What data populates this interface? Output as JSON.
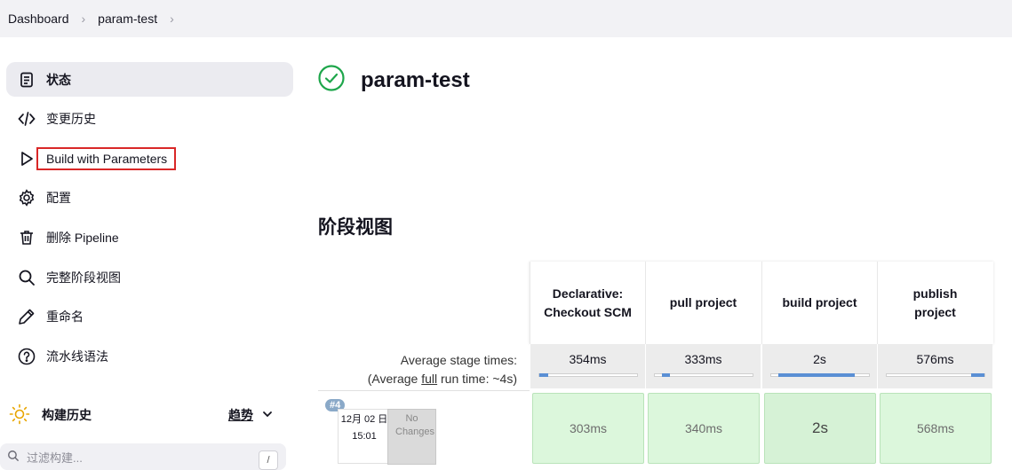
{
  "breadcrumb": {
    "items": [
      "Dashboard",
      "param-test"
    ]
  },
  "sidebar": {
    "items": [
      {
        "label": "状态",
        "icon": "document-icon",
        "active": true
      },
      {
        "label": "变更历史",
        "icon": "code-icon"
      },
      {
        "label": "Build with Parameters",
        "icon": "play-icon",
        "highlighted": true
      },
      {
        "label": "配置",
        "icon": "gear-icon"
      },
      {
        "label": "删除 Pipeline",
        "icon": "trash-icon"
      },
      {
        "label": "完整阶段视图",
        "icon": "search-icon"
      },
      {
        "label": "重命名",
        "icon": "pencil-icon"
      },
      {
        "label": "流水线语法",
        "icon": "help-icon"
      }
    ]
  },
  "build_history": {
    "title": "构建历史",
    "trend_label": "趋势",
    "filter_placeholder": "过滤构建...",
    "filter_shortcut": "/"
  },
  "main": {
    "title": "param-test",
    "status_color": "#1ea64b",
    "stage_view_title": "阶段视图",
    "avg_label_line1": "Average stage times:",
    "avg_label_line2_prefix": "(Average ",
    "avg_label_line2_link": "full",
    "avg_label_line2_suffix": " run time: ~4s)"
  },
  "stages": [
    {
      "name": "Declarative: Checkout SCM",
      "avg": "354ms",
      "avg_fraction": 0.09,
      "run": "303ms"
    },
    {
      "name": "pull project",
      "avg": "333ms",
      "avg_fraction": 0.08,
      "run": "340ms"
    },
    {
      "name": "build project",
      "avg": "2s",
      "avg_fraction": 0.78,
      "run": "2s"
    },
    {
      "name": "publish project",
      "avg": "576ms",
      "avg_fraction": 0.14,
      "run": "568ms"
    }
  ],
  "run": {
    "number": "#4",
    "date": "12月 02 日",
    "time": "15:01",
    "changes": "No Changes"
  }
}
